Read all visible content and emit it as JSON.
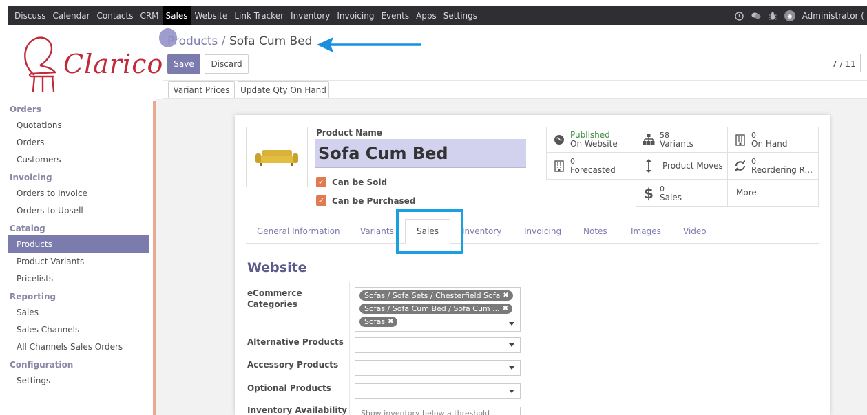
{
  "topbar": {
    "menu": [
      "Discuss",
      "Calendar",
      "Contacts",
      "CRM",
      "Sales",
      "Website",
      "Link Tracker",
      "Inventory",
      "Invoicing",
      "Events",
      "Apps",
      "Settings"
    ],
    "active": "Sales",
    "user": "Administrator ("
  },
  "logo": {
    "text": "Clarico"
  },
  "sidebar": {
    "sections": [
      {
        "title": "Orders",
        "items": [
          "Quotations",
          "Orders",
          "Customers"
        ]
      },
      {
        "title": "Invoicing",
        "items": [
          "Orders to Invoice",
          "Orders to Upsell"
        ]
      },
      {
        "title": "Catalog",
        "items": [
          "Products",
          "Product Variants",
          "Pricelists"
        ]
      },
      {
        "title": "Reporting",
        "items": [
          "Sales",
          "Sales Channels",
          "All Channels Sales Orders"
        ]
      },
      {
        "title": "Configuration",
        "items": [
          "Settings"
        ]
      }
    ],
    "active_item": "Products"
  },
  "breadcrumb": {
    "parent": "Products",
    "separator": " / ",
    "current": "Sofa Cum Bed"
  },
  "buttons": {
    "save": "Save",
    "discard": "Discard",
    "variant_prices": "Variant Prices",
    "update_qty": "Update Qty On Hand"
  },
  "pager": "7 / 11",
  "product": {
    "name_label": "Product Name",
    "name": "Sofa Cum Bed",
    "can_be_sold": "Can be Sold",
    "can_be_purchased": "Can be Purchased"
  },
  "stats": {
    "published": {
      "line1": "Published",
      "line2": "On Website"
    },
    "variants": {
      "num": "58",
      "label": "Variants"
    },
    "on_hand": {
      "num": "0",
      "label": "On Hand"
    },
    "forecasted": {
      "num": "0",
      "label": "Forecasted"
    },
    "moves": {
      "label": "Product Moves"
    },
    "reordering": {
      "num": "0",
      "label": "Reordering R..."
    },
    "sales": {
      "num": "0",
      "label": "Sales"
    },
    "more": {
      "label": "More"
    }
  },
  "tabs": [
    "General Information",
    "Variants",
    "Sales",
    "Inventory",
    "Invoicing",
    "Notes",
    "Images",
    "Video"
  ],
  "active_tab": "Sales",
  "website_section": {
    "title": "Website",
    "ecommerce_label_1": "eCommerce",
    "ecommerce_label_2": "Categories",
    "tags": [
      "Sofas / Sofa Sets / Chesterfield Sofa",
      "Sofas / Sofa Cum Bed / Sofa Cum ...",
      "Sofas"
    ],
    "alternative_label": "Alternative Products",
    "accessory_label": "Accessory Products",
    "optional_label": "Optional Products",
    "inventory_label": "Inventory Availability",
    "inventory_value": "Show inventory below a threshold"
  },
  "colors": {
    "primary": "#7c7bad",
    "topbar": "#2f2e33",
    "highlight": "#1aa0e0",
    "checkbox": "#e07a50"
  }
}
